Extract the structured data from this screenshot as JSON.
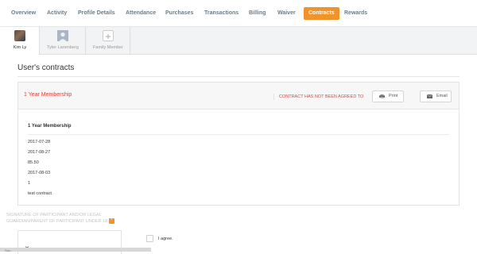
{
  "nav": {
    "tabs": [
      {
        "label": "Overview"
      },
      {
        "label": "Activity"
      },
      {
        "label": "Profile Details"
      },
      {
        "label": "Attendance"
      },
      {
        "label": "Purchases"
      },
      {
        "label": "Transactions"
      },
      {
        "label": "Billing"
      },
      {
        "label": "Waiver"
      },
      {
        "label": "Contracts"
      },
      {
        "label": "Rewards"
      }
    ],
    "active_tab": "Contracts",
    "accent_color": "#f0932b"
  },
  "members": [
    {
      "name": "Kim Ly",
      "avatar": "photo-avatar"
    },
    {
      "name": "Tyler Lanenberg",
      "avatar": "user-silhouette-icon"
    },
    {
      "name": "Family Member",
      "avatar": "plus-icon"
    }
  ],
  "main": {
    "title": "User's contracts",
    "contract": {
      "name": "1 Year Membership",
      "status": "CONTRACT HAS NOT BEEN AGREED TO",
      "status_color": "#e0423b",
      "print_label": "Print",
      "email_label": "Email",
      "detail_title": "1 Year Membership",
      "details": [
        "2017-07-28",
        "2017-08-27",
        "85.50",
        "2017-08-03",
        "1",
        "test contract"
      ]
    },
    "signature": {
      "label": "SIGNATURE OF PARTICIPANT AND/OR LEGAL GUARDIAN/PARENT OF PARTICIPANT UNDER 18",
      "required_badge": "*",
      "mark": "✕",
      "agree_label": "I agree."
    }
  },
  "footer": {
    "text": "Sav..."
  }
}
